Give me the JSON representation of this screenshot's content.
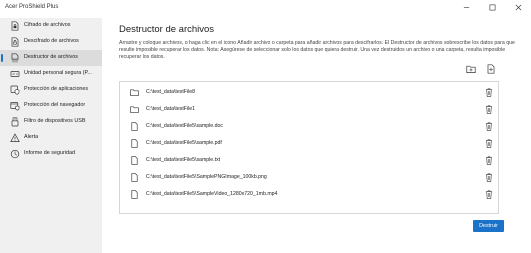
{
  "window": {
    "title": "Acer ProShield Plus"
  },
  "sidebar": {
    "items": [
      {
        "label": "Cifrado de archivos",
        "icon": "file-lock-icon"
      },
      {
        "label": "Descifrado de archivos",
        "icon": "file-unlock-icon"
      },
      {
        "label": "Destructor de archivos",
        "icon": "file-shredder-icon",
        "active": true
      },
      {
        "label": "Unidad personal segura (P...",
        "icon": "secure-drive-icon"
      },
      {
        "label": "Protección de aplicaciones",
        "icon": "app-shield-icon"
      },
      {
        "label": "Protección del navegador",
        "icon": "browser-shield-icon"
      },
      {
        "label": "Filtro de dispositivos USB",
        "icon": "usb-icon"
      },
      {
        "label": "Alerta",
        "icon": "alert-icon"
      },
      {
        "label": "Informe de seguridad",
        "icon": "report-icon"
      }
    ]
  },
  "main": {
    "title": "Destructor de archivos",
    "description": "Arrastre y coloque archivos, o haga clic en el icono Añadir archivo o carpeta para añadir archivos para descifrarlos. El Destructor de archivos sobrescribe los datos para que resulte imposible recuperar los datos. Nota: Asegúrese de seleccionar solo los datos que quiera destruir. Una vez destruidos un archivo o una carpeta, resulta imposible recuperar los datos.",
    "toolbar": {
      "add_folder_icon": "add-folder-icon",
      "add_file_icon": "add-file-icon"
    },
    "files": [
      {
        "path": "C:\\test_data\\testFile8",
        "type": "folder"
      },
      {
        "path": "C:\\test_data\\testFile1",
        "type": "folder"
      },
      {
        "path": "C:\\test_data\\testFile5\\sample.doc",
        "type": "file"
      },
      {
        "path": "C:\\test_data\\testFile5\\sample.pdf",
        "type": "file"
      },
      {
        "path": "C:\\test_data\\testFile5\\sample.txt",
        "type": "file"
      },
      {
        "path": "C:\\test_data\\testFile5\\SamplePNGImage_100kb.png",
        "type": "file"
      },
      {
        "path": "C:\\test_data\\testFile5\\SampleVideo_1280x720_1mb.mp4",
        "type": "file"
      }
    ],
    "destroy_label": "Destruir"
  },
  "colors": {
    "accent": "#1a73c9",
    "sidebar_bg": "#f0f0f0",
    "active_item_bg": "#dcdcdc"
  }
}
